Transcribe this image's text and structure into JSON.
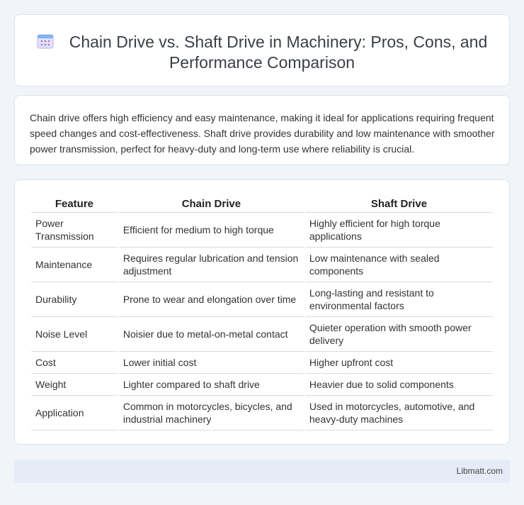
{
  "header": {
    "icon": "calendar-icon",
    "title": "Chain Drive vs. Shaft Drive in Machinery: Pros, Cons, and Performance Comparison"
  },
  "summary": {
    "text": "Chain drive offers high efficiency and easy maintenance, making it ideal for applications requiring frequent speed changes and cost-effectiveness. Shaft drive provides durability and low maintenance with smoother power transmission, perfect for heavy-duty and long-term use where reliability is crucial."
  },
  "table": {
    "headers": [
      "Feature",
      "Chain Drive",
      "Shaft Drive"
    ],
    "rows": [
      [
        "Power Transmission",
        "Efficient for medium to high torque",
        "Highly efficient for high torque applications"
      ],
      [
        "Maintenance",
        "Requires regular lubrication and tension adjustment",
        "Low maintenance with sealed components"
      ],
      [
        "Durability",
        "Prone to wear and elongation over time",
        "Long-lasting and resistant to environmental factors"
      ],
      [
        "Noise Level",
        "Noisier due to metal-on-metal contact",
        "Quieter operation with smooth power delivery"
      ],
      [
        "Cost",
        "Lower initial cost",
        "Higher upfront cost"
      ],
      [
        "Weight",
        "Lighter compared to shaft drive",
        "Heavier due to solid components"
      ],
      [
        "Application",
        "Common in motorcycles, bicycles, and industrial machinery",
        "Used in motorcycles, automotive, and heavy-duty machines"
      ]
    ]
  },
  "footer": {
    "site": "Libmatt.com"
  },
  "colors": {
    "background": "#f1f4f9",
    "footer_bg": "#e5ecf7",
    "icon_accent": "#8b7fd6"
  }
}
